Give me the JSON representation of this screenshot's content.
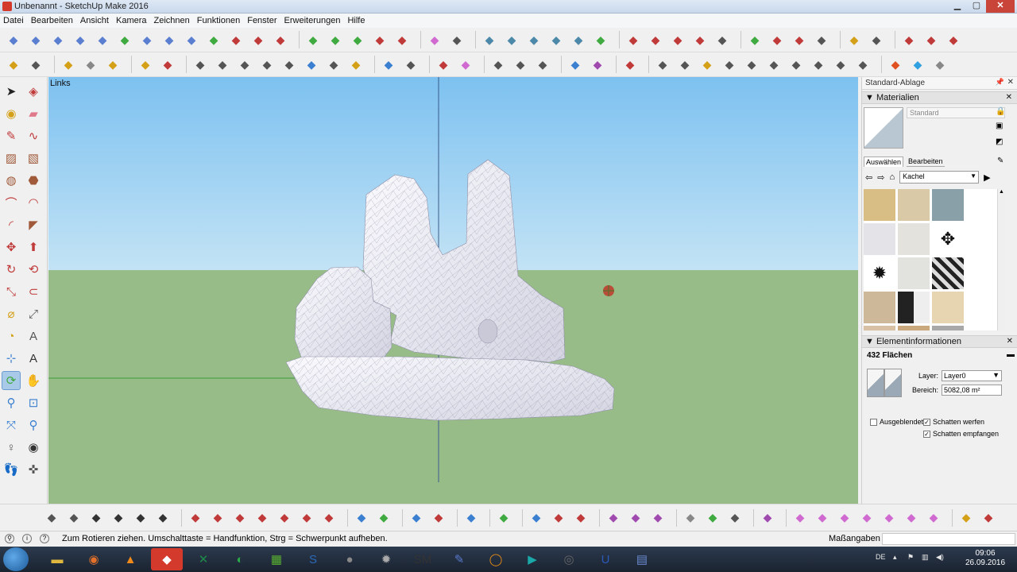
{
  "window": {
    "title": "Unbenannt - SketchUp Make 2016"
  },
  "menu": [
    "Datei",
    "Bearbeiten",
    "Ansicht",
    "Kamera",
    "Zeichnen",
    "Funktionen",
    "Fenster",
    "Erweiterungen",
    "Hilfe"
  ],
  "toolbar1_icons": [
    {
      "icon": "freehand-icon",
      "color": "#5a7fd0"
    },
    {
      "icon": "arc-line-icon",
      "color": "#5a7fd0"
    },
    {
      "icon": "spring-icon",
      "color": "#5a7fd0"
    },
    {
      "icon": "zigzag-icon",
      "color": "#5a7fd0"
    },
    {
      "icon": "polyline-icon",
      "color": "#5a7fd0"
    },
    {
      "icon": "bezier-icon",
      "color": "#3faa3f"
    },
    {
      "icon": "rectangle-icon",
      "color": "#5a7fd0"
    },
    {
      "icon": "circle-icon",
      "color": "#5a7fd0"
    },
    {
      "icon": "arc-icon",
      "color": "#5a7fd0"
    },
    {
      "icon": "spline-icon",
      "color": "#3faa3f"
    },
    {
      "icon": "curve-icon",
      "color": "#c03a3a"
    },
    {
      "icon": "curve2-icon",
      "color": "#c03a3a"
    },
    {
      "icon": "arc3-icon",
      "color": "#c03a3a"
    },
    {
      "icon": "sep"
    },
    {
      "icon": "line-icon",
      "color": "#3faa3f"
    },
    {
      "icon": "polygon-icon",
      "color": "#3faa3f"
    },
    {
      "icon": "wrench-icon",
      "color": "#3faa3f"
    },
    {
      "icon": "ellipse-icon",
      "color": "#c03a3a"
    },
    {
      "icon": "triangle-icon",
      "color": "#c03a3a"
    },
    {
      "icon": "sep"
    },
    {
      "icon": "color-cube-icon",
      "color": "#d06ad0"
    },
    {
      "icon": "cursor-select-icon",
      "color": "#555"
    },
    {
      "icon": "sep"
    },
    {
      "icon": "solid-1-icon",
      "color": "#4c88a8"
    },
    {
      "icon": "solid-2-icon",
      "color": "#4c88a8"
    },
    {
      "icon": "solid-3-icon",
      "color": "#4c88a8"
    },
    {
      "icon": "solid-4-icon",
      "color": "#4c88a8"
    },
    {
      "icon": "solid-5-icon",
      "color": "#4c88a8"
    },
    {
      "icon": "solid-6-icon",
      "color": "#3faa3f"
    },
    {
      "icon": "sep"
    },
    {
      "icon": "trim-icon",
      "color": "#c03a3a"
    },
    {
      "icon": "split-icon",
      "color": "#c03a3a"
    },
    {
      "icon": "join-icon",
      "color": "#c03a3a"
    },
    {
      "icon": "stamp-icon",
      "color": "#c03a3a"
    },
    {
      "icon": "hammer-icon",
      "color": "#555"
    },
    {
      "icon": "sep"
    },
    {
      "icon": "push-icon",
      "color": "#3faa3f"
    },
    {
      "icon": "scissors-icon",
      "color": "#c03a3a"
    },
    {
      "icon": "fold-icon",
      "color": "#c03a3a"
    },
    {
      "icon": "knife-icon",
      "color": "#555"
    },
    {
      "icon": "sep"
    },
    {
      "icon": "gold-ball-icon",
      "color": "#d4a017"
    },
    {
      "icon": "tools-icon",
      "color": "#555"
    },
    {
      "icon": "sep"
    },
    {
      "icon": "section-1-icon",
      "color": "#c03a3a"
    },
    {
      "icon": "section-2-icon",
      "color": "#c03a3a"
    },
    {
      "icon": "section-3-icon",
      "color": "#c03a3a"
    }
  ],
  "toolbar2_icons": [
    {
      "icon": "pencil-ruler-icon",
      "color": "#d4a017"
    },
    {
      "icon": "offset-icon",
      "color": "#555"
    },
    {
      "icon": "sep"
    },
    {
      "icon": "box-icon",
      "color": "#d4a017"
    },
    {
      "icon": "box2-icon",
      "color": "#888"
    },
    {
      "icon": "box3-icon",
      "color": "#d4a017"
    },
    {
      "icon": "sep"
    },
    {
      "icon": "lasso-icon",
      "color": "#d4a017"
    },
    {
      "icon": "eraser-icon",
      "color": "#c03a3a"
    },
    {
      "icon": "sep"
    },
    {
      "icon": "shape-1-icon",
      "color": "#555"
    },
    {
      "icon": "shape-2-icon",
      "color": "#555"
    },
    {
      "icon": "shape-3-icon",
      "color": "#555"
    },
    {
      "icon": "shape-4-icon",
      "color": "#555"
    },
    {
      "icon": "shape-5-icon",
      "color": "#555"
    },
    {
      "icon": "shape-6-icon",
      "color": "#3a7fd0"
    },
    {
      "icon": "shape-7-icon",
      "color": "#555"
    },
    {
      "icon": "shape-8-icon",
      "color": "#d4a017"
    },
    {
      "icon": "sep"
    },
    {
      "icon": "chain-icon",
      "color": "#3a7fd0"
    },
    {
      "icon": "chain2-icon",
      "color": "#555"
    },
    {
      "icon": "sep"
    },
    {
      "icon": "resize-icon",
      "color": "#c03a3a"
    },
    {
      "icon": "eraser2-icon",
      "color": "#d06ad0"
    },
    {
      "icon": "sep"
    },
    {
      "icon": "move-left-icon",
      "color": "#555"
    },
    {
      "icon": "pivot-icon",
      "color": "#555"
    },
    {
      "icon": "star-icon",
      "color": "#555"
    },
    {
      "icon": "sep"
    },
    {
      "icon": "pattern-icon",
      "color": "#3a7fd0"
    },
    {
      "icon": "cube-purple-icon",
      "color": "#a04ab0"
    },
    {
      "icon": "sep"
    },
    {
      "icon": "book-icon",
      "color": "#c03a3a"
    },
    {
      "icon": "sep"
    },
    {
      "icon": "roof-1-icon",
      "color": "#555"
    },
    {
      "icon": "roof-2-icon",
      "color": "#555"
    },
    {
      "icon": "roof-3-icon",
      "color": "#d4a017"
    },
    {
      "icon": "roof-4-icon",
      "color": "#555"
    },
    {
      "icon": "roof-5-icon",
      "color": "#555"
    },
    {
      "icon": "roof-6-icon",
      "color": "#555"
    },
    {
      "icon": "roof-7-icon",
      "color": "#555"
    },
    {
      "icon": "roof-8-icon",
      "color": "#555"
    },
    {
      "icon": "roof-9-icon",
      "color": "#555"
    },
    {
      "icon": "roof-10-icon",
      "color": "#555"
    },
    {
      "icon": "sep"
    },
    {
      "icon": "cube-red-icon",
      "color": "#e05020"
    },
    {
      "icon": "cube-blue-icon",
      "color": "#30a0e0"
    },
    {
      "icon": "cube-grey-icon",
      "color": "#888"
    }
  ],
  "left_tools": [
    {
      "icon": "select-arrow-icon",
      "glyph": "➤",
      "color": "#222"
    },
    {
      "icon": "make-component-icon",
      "glyph": "◈",
      "color": "#c03a3a"
    },
    {
      "icon": "paint-bucket-icon",
      "glyph": "◉",
      "color": "#d4a017"
    },
    {
      "icon": "eraser-icon",
      "glyph": "▰",
      "color": "#e07a8a"
    },
    {
      "icon": "pencil-icon",
      "glyph": "✎",
      "color": "#c03a3a"
    },
    {
      "icon": "freehand-icon",
      "glyph": "∿",
      "color": "#c03a3a"
    },
    {
      "icon": "rectangle-icon",
      "glyph": "▨",
      "color": "#a05a3a"
    },
    {
      "icon": "rotated-rectangle-icon",
      "glyph": "▧",
      "color": "#a05a3a"
    },
    {
      "icon": "circle-icon",
      "glyph": "◍",
      "color": "#a05a3a"
    },
    {
      "icon": "polygon-icon",
      "glyph": "⬣",
      "color": "#a05a3a"
    },
    {
      "icon": "arc-icon",
      "glyph": "⌒",
      "color": "#c03a3a"
    },
    {
      "icon": "two-point-arc-icon",
      "glyph": "◠",
      "color": "#c03a3a"
    },
    {
      "icon": "three-point-arc-icon",
      "glyph": "◜",
      "color": "#c03a3a"
    },
    {
      "icon": "pie-icon",
      "glyph": "◤",
      "color": "#a05a3a"
    },
    {
      "icon": "move-icon",
      "glyph": "✥",
      "color": "#c03a3a"
    },
    {
      "icon": "push-pull-icon",
      "glyph": "⬆",
      "color": "#c03a3a"
    },
    {
      "icon": "rotate-icon",
      "glyph": "↻",
      "color": "#c03a3a"
    },
    {
      "icon": "follow-me-icon",
      "glyph": "⟲",
      "color": "#c03a3a"
    },
    {
      "icon": "scale-icon",
      "glyph": "⤡",
      "color": "#c03a3a"
    },
    {
      "icon": "offset-icon",
      "glyph": "⊂",
      "color": "#c03a3a"
    },
    {
      "icon": "tape-measure-icon",
      "glyph": "⌀",
      "color": "#d4a017"
    },
    {
      "icon": "dimension-icon",
      "glyph": "⤢",
      "color": "#555"
    },
    {
      "icon": "protractor-icon",
      "glyph": "◔",
      "color": "#d4a017"
    },
    {
      "icon": "text-icon",
      "glyph": "A",
      "color": "#555"
    },
    {
      "icon": "axes-icon",
      "glyph": "⊹",
      "color": "#3a7fd0"
    },
    {
      "icon": "3d-text-icon",
      "glyph": "A",
      "color": "#333"
    },
    {
      "icon": "orbit-icon",
      "glyph": "⟳",
      "color": "#3faa3f"
    },
    {
      "icon": "pan-icon",
      "glyph": "✋",
      "color": "#d4a017"
    },
    {
      "icon": "zoom-icon",
      "glyph": "⚲",
      "color": "#3a7fd0"
    },
    {
      "icon": "zoom-window-icon",
      "glyph": "⊡",
      "color": "#3a7fd0"
    },
    {
      "icon": "zoom-extents-icon",
      "glyph": "⤧",
      "color": "#3a7fd0"
    },
    {
      "icon": "previous-view-icon",
      "glyph": "⚲",
      "color": "#3a7fd0"
    },
    {
      "icon": "position-camera-icon",
      "glyph": "♀",
      "color": "#555"
    },
    {
      "icon": "look-around-icon",
      "glyph": "◉",
      "color": "#333"
    },
    {
      "icon": "walk-icon",
      "glyph": "👣",
      "color": "#333"
    },
    {
      "icon": "section-plane-icon",
      "glyph": "✜",
      "color": "#555"
    }
  ],
  "viewport": {
    "label": "Links",
    "sky_color": "#7dc1f0",
    "sky_light": "#c3e3f5",
    "ground_color": "#98bc88"
  },
  "tray": {
    "title": "Standard-Ablage",
    "materials": {
      "header": "Materialien",
      "name": "Standard",
      "tab_select": "Auswählen",
      "tab_edit": "Bearbeiten",
      "collection": "Kachel",
      "swatches": [
        "#d8bd84",
        "#d9c9a6",
        "#8aa0a8",
        "#e3e3e8",
        "#e4e2dc",
        "#ffffff",
        "#ffffff",
        "#e2e2de",
        "#3c3c3c",
        "#cdb99a",
        "#252525",
        "#e7d4b0",
        "#d7c0a4",
        "#c9a87e",
        "#a8a8a8"
      ]
    },
    "entity_info": {
      "header": "Elementinformationen",
      "count": "432 Flächen",
      "layer_label": "Layer:",
      "layer_value": "Layer0",
      "area_label": "Bereich:",
      "area_value": "5082,08 m²",
      "hidden_label": "Ausgeblendet",
      "cast_label": "Schatten werfen",
      "receive_label": "Schatten empfangen"
    }
  },
  "bottom_icons": [
    {
      "icon": "iso-view-icon",
      "color": "#555"
    },
    {
      "icon": "top-view-icon",
      "color": "#555"
    },
    {
      "icon": "home-icon",
      "color": "#333"
    },
    {
      "icon": "house-front-icon",
      "color": "#333"
    },
    {
      "icon": "house-right-icon",
      "color": "#333"
    },
    {
      "icon": "house-back-icon",
      "color": "#333"
    },
    {
      "icon": "sep"
    },
    {
      "icon": "sandbox-1-icon",
      "color": "#c03a3a"
    },
    {
      "icon": "sandbox-2-icon",
      "color": "#c03a3a"
    },
    {
      "icon": "sandbox-3-icon",
      "color": "#c03a3a"
    },
    {
      "icon": "sandbox-4-icon",
      "color": "#c03a3a"
    },
    {
      "icon": "sandbox-5-icon",
      "color": "#c03a3a"
    },
    {
      "icon": "sandbox-6-icon",
      "color": "#c03a3a"
    },
    {
      "icon": "sandbox-7-icon",
      "color": "#c03a3a"
    },
    {
      "icon": "sep"
    },
    {
      "icon": "paint-face-icon",
      "color": "#3a7fd0"
    },
    {
      "icon": "vertical-line-icon",
      "color": "#3faa3f"
    },
    {
      "icon": "sep"
    },
    {
      "icon": "align-icon",
      "color": "#3a7fd0"
    },
    {
      "icon": "align2-icon",
      "color": "#c03a3a"
    },
    {
      "icon": "sep"
    },
    {
      "icon": "measure-icon",
      "color": "#3a7fd0"
    },
    {
      "icon": "sep"
    },
    {
      "icon": "flip-icon",
      "color": "#3faa3f"
    },
    {
      "icon": "sep"
    },
    {
      "icon": "undo-curve-icon",
      "color": "#3a7fd0"
    },
    {
      "icon": "redo-curve-icon",
      "color": "#c03a3a"
    },
    {
      "icon": "hand-red-icon",
      "color": "#c03a3a"
    },
    {
      "icon": "sep"
    },
    {
      "icon": "gem-1-icon",
      "color": "#a04ab0"
    },
    {
      "icon": "gem-2-icon",
      "color": "#a04ab0"
    },
    {
      "icon": "gem-3-icon",
      "color": "#a04ab0"
    },
    {
      "icon": "sep"
    },
    {
      "icon": "shield-icon",
      "color": "#888"
    },
    {
      "icon": "tree-icon",
      "color": "#3faa3f"
    },
    {
      "icon": "leaf-icon",
      "color": "#555"
    },
    {
      "icon": "sep"
    },
    {
      "icon": "tools-g3-icon",
      "color": "#a04ab0"
    },
    {
      "icon": "sep"
    },
    {
      "icon": "curve-1-icon",
      "color": "#d06ad0"
    },
    {
      "icon": "curve-2-icon",
      "color": "#d06ad0"
    },
    {
      "icon": "curve-3-icon",
      "color": "#d06ad0"
    },
    {
      "icon": "curve-4-icon",
      "color": "#d06ad0"
    },
    {
      "icon": "curve-5-icon",
      "color": "#d06ad0"
    },
    {
      "icon": "curve-6-icon",
      "color": "#d06ad0"
    },
    {
      "icon": "curve-7-icon",
      "color": "#d06ad0"
    },
    {
      "icon": "sep"
    },
    {
      "icon": "spark-1-icon",
      "color": "#d4a017"
    },
    {
      "icon": "spark-2-icon",
      "color": "#c03a3a"
    }
  ],
  "status": {
    "hint": "Zum Rotieren ziehen. Umschalttaste = Handfunktion, Strg = Schwerpunkt aufheben.",
    "measurements_label": "Maßangaben"
  },
  "taskbar": {
    "apps": [
      {
        "icon": "folder-icon",
        "color": "#e0b840",
        "glyph": "▬"
      },
      {
        "icon": "firefox-icon",
        "color": "#e0702a",
        "glyph": "◉"
      },
      {
        "icon": "vlc-icon",
        "color": "#f08a1a",
        "glyph": "▲"
      },
      {
        "icon": "sketchup-icon",
        "color": "#d43a2b",
        "glyph": "◆"
      },
      {
        "icon": "xing-icon",
        "color": "#1e8a4a",
        "glyph": "✕"
      },
      {
        "icon": "green-app-icon",
        "color": "#2aa84a",
        "glyph": "◐"
      },
      {
        "icon": "grid-app-icon",
        "color": "#58b030",
        "glyph": "▦"
      },
      {
        "icon": "s-app-icon",
        "color": "#2a6ab8",
        "glyph": "S"
      },
      {
        "icon": "ball-app-icon",
        "color": "#888",
        "glyph": "●"
      },
      {
        "icon": "gear-app-icon",
        "color": "#aaa",
        "glyph": "✹"
      },
      {
        "icon": "sm-app-icon",
        "color": "#333",
        "glyph": "SM"
      },
      {
        "icon": "edit-app-icon",
        "color": "#5a7ad0",
        "glyph": "✎"
      },
      {
        "icon": "orange-app-icon",
        "color": "#e08a1a",
        "glyph": "◯"
      },
      {
        "icon": "play-app-icon",
        "color": "#1aa8a8",
        "glyph": "▶"
      },
      {
        "icon": "disc-app-icon",
        "color": "#666",
        "glyph": "◎"
      },
      {
        "icon": "u-app-icon",
        "color": "#2a5ab8",
        "glyph": "U"
      },
      {
        "icon": "film-app-icon",
        "color": "#6a8ad0",
        "glyph": "▤"
      }
    ],
    "lang": "DE",
    "time": "09:06",
    "date": "26.09.2016"
  }
}
